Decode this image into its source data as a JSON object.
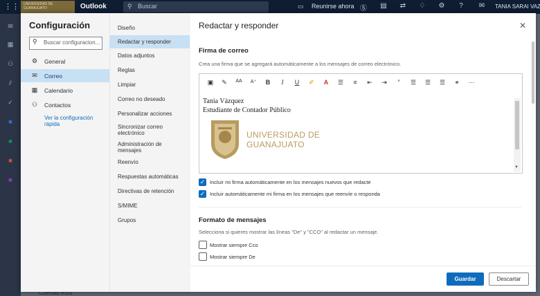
{
  "topbar": {
    "app_title": "Outlook",
    "search_placeholder": "Buscar",
    "meet_now": "Reunirse ahora",
    "user_name": "TANIA SARAI VAZ",
    "logo_text": "UNIVERSIDAD DE GUANAJUATO"
  },
  "background": {
    "bottom_text": "Cuentas RSS"
  },
  "settings": {
    "title": "Configuración",
    "search_placeholder": "Buscar configuracion...",
    "nav": [
      {
        "label": "General",
        "icon": "gear-icon"
      },
      {
        "label": "Correo",
        "icon": "mail-icon"
      },
      {
        "label": "Calendario",
        "icon": "calendar-icon"
      },
      {
        "label": "Contactos",
        "icon": "people-icon"
      }
    ],
    "quick_link": "Ver la configuración rápida",
    "subnav": [
      "Diseño",
      "Redactar y responder",
      "Datos adjuntos",
      "Reglas",
      "Limpiar",
      "Correo no deseado",
      "Personalizar acciones",
      "Sincronizar correo electrónico",
      "Administración de mensajes",
      "Reenvío",
      "Respuestas automáticas",
      "Directivas de retención",
      "S/MIME",
      "Grupos"
    ]
  },
  "main": {
    "title": "Redactar y responder",
    "signature": {
      "title": "Firma de correo",
      "description": "Crea una firma que se agregará automáticamente a los mensajes de correo electrónico.",
      "line1": "Tania Vázquez",
      "line2": "Estudiante de Contador Público",
      "logo_line1": "UNIVERSIDAD DE",
      "logo_line2": "GUANAJUATO",
      "check_new": "Incluir mi firma automáticamente en los mensajes nuevos que redacte",
      "check_new_checked": true,
      "check_reply": "Incluir automáticamente mi firma en los mensajes que reenvíe o responda",
      "check_reply_checked": true
    },
    "format": {
      "title": "Formato de mensajes",
      "description": "Selecciona si quieres mostrar las líneas \"De\" y \"CCO\" al redactar un mensaje.",
      "option_bcc": "Mostrar siempre Cco",
      "option_bcc_checked": false,
      "option_from": "Mostrar siempre De",
      "option_from_checked": false
    }
  },
  "buttons": {
    "save": "Guardar",
    "discard": "Descartar"
  },
  "colors": {
    "accent": "#0f6cbd",
    "selected_bg": "#c7e0f4",
    "topbar": "#0f1d33",
    "logo_gold": "#b89b5e"
  }
}
